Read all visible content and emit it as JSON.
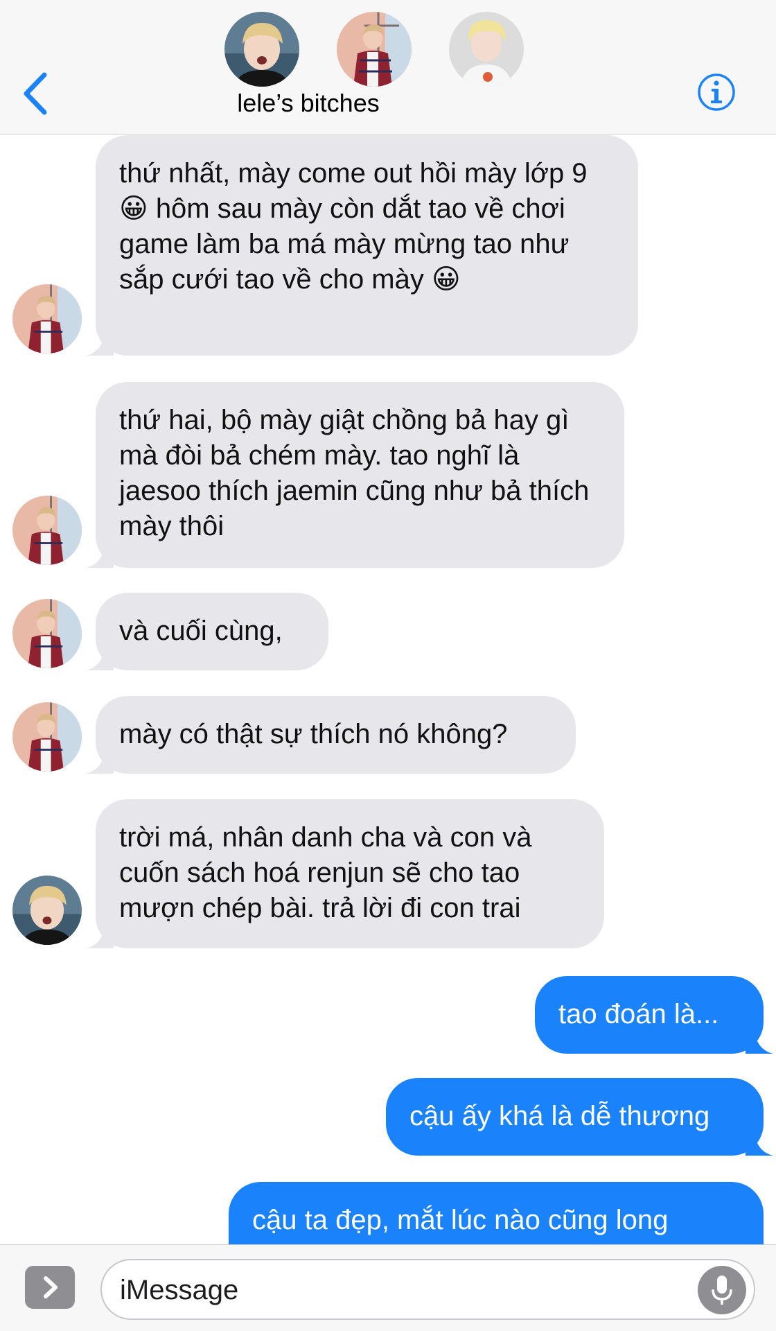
{
  "header": {
    "group_name": "lele’s bitches",
    "accent_color": "#1a82fb",
    "avatars": [
      "member-avatar-1",
      "member-avatar-2",
      "member-avatar-3"
    ]
  },
  "messages": [
    {
      "direction": "incoming",
      "text": "thứ nhất, mày come out hồi mày lớp 9 😀 hôm sau mày còn dắt tao về chơi game làm ba má mày mừng tao như sắp cưới tao về cho mày 😀",
      "avatar": "member-avatar-2"
    },
    {
      "direction": "incoming",
      "text": "thứ hai, bộ mày giật chồng bả hay gì mà đòi bả chém mày. tao nghĩ là jaesoo thích jaemin cũng như bả thích mày thôi",
      "avatar": "member-avatar-2"
    },
    {
      "direction": "incoming",
      "text": "và cuối cùng,",
      "avatar": "member-avatar-2"
    },
    {
      "direction": "incoming",
      "text": "mày có thật sự thích nó không?",
      "avatar": "member-avatar-2"
    },
    {
      "direction": "incoming",
      "text": "trời má, nhân danh cha và con và cuốn sách hoá renjun sẽ cho tao mượn chép bài. trả lời đi con trai",
      "avatar": "member-avatar-1"
    },
    {
      "direction": "outgoing",
      "text": "tao đoán là..."
    },
    {
      "direction": "outgoing",
      "text": "cậu ấy khá là dễ thương"
    },
    {
      "direction": "outgoing",
      "text": "cậu ta đẹp, mắt lúc nào cũng long"
    }
  ],
  "input": {
    "placeholder": "iMessage"
  }
}
